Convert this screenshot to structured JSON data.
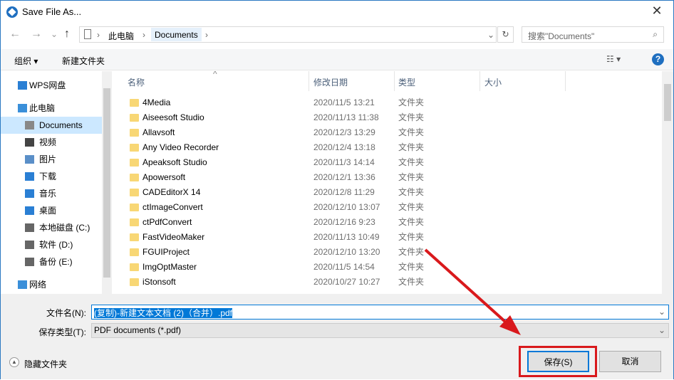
{
  "window": {
    "title": "Save File As...",
    "close": "✕"
  },
  "nav": {
    "back": "←",
    "forward": "→",
    "recent": "⌄",
    "up": "↑",
    "crumbs": [
      "此电脑",
      "Documents"
    ],
    "search_placeholder": "搜索\"Documents\"",
    "refresh": "↻",
    "search_icon": "⌕"
  },
  "toolbar": {
    "organize": "组织 ▾",
    "new_folder": "新建文件夹",
    "view": "☷ ▾",
    "help": "?"
  },
  "sidebar": [
    {
      "label": "WPS网盘",
      "icon": "cloud-icon"
    },
    {
      "label": "此电脑",
      "icon": "computer-icon"
    },
    {
      "label": "Documents",
      "icon": "document-icon",
      "selected": true
    },
    {
      "label": "视频",
      "icon": "video-icon"
    },
    {
      "label": "图片",
      "icon": "picture-icon"
    },
    {
      "label": "下载",
      "icon": "download-icon"
    },
    {
      "label": "音乐",
      "icon": "music-icon"
    },
    {
      "label": "桌面",
      "icon": "desktop-icon"
    },
    {
      "label": "本地磁盘 (C:)",
      "icon": "drive-icon"
    },
    {
      "label": "软件 (D:)",
      "icon": "drive-icon"
    },
    {
      "label": "备份 (E:)",
      "icon": "drive-icon"
    },
    {
      "label": "网络",
      "icon": "network-icon"
    }
  ],
  "columns": [
    "名称",
    "修改日期",
    "类型",
    "大小"
  ],
  "files": [
    {
      "name": "4Media",
      "date": "2020/11/5 13:21",
      "type": "文件夹"
    },
    {
      "name": "Aiseesoft Studio",
      "date": "2020/11/13 11:38",
      "type": "文件夹"
    },
    {
      "name": "Allavsoft",
      "date": "2020/12/3 13:29",
      "type": "文件夹"
    },
    {
      "name": "Any Video Recorder",
      "date": "2020/12/4 13:18",
      "type": "文件夹"
    },
    {
      "name": "Apeaksoft Studio",
      "date": "2020/11/3 14:14",
      "type": "文件夹"
    },
    {
      "name": "Apowersoft",
      "date": "2020/12/1 13:36",
      "type": "文件夹"
    },
    {
      "name": "CADEditorX 14",
      "date": "2020/12/8 11:29",
      "type": "文件夹"
    },
    {
      "name": "ctImageConvert",
      "date": "2020/12/10 13:07",
      "type": "文件夹"
    },
    {
      "name": "ctPdfConvert",
      "date": "2020/12/16 9:23",
      "type": "文件夹"
    },
    {
      "name": "FastVideoMaker",
      "date": "2020/11/13 10:49",
      "type": "文件夹"
    },
    {
      "name": "FGUIProject",
      "date": "2020/12/10 13:20",
      "type": "文件夹"
    },
    {
      "name": "ImgOptMaster",
      "date": "2020/11/5 14:54",
      "type": "文件夹"
    },
    {
      "name": "iStonsoft",
      "date": "2020/10/27 10:27",
      "type": "文件夹"
    }
  ],
  "form": {
    "filename_label": "文件名(N):",
    "filename": "(复制)-新建文本文档 (2)（合并）.pdf",
    "type_label": "保存类型(T):",
    "type": "PDF documents (*.pdf)",
    "hide_folders": "隐藏文件夹",
    "save": "保存(S)",
    "cancel": "取消"
  },
  "colors": {
    "accent": "#0078d7",
    "annotation": "#d9191c"
  }
}
